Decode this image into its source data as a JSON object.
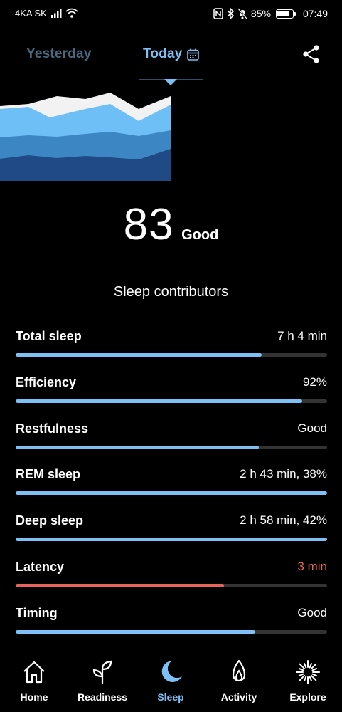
{
  "status_bar": {
    "carrier": "4KA SK",
    "battery": "85%",
    "battery_level": 0.85,
    "time": "07:49"
  },
  "tabs": {
    "yesterday": "Yesterday",
    "today": "Today",
    "active": "today"
  },
  "score": {
    "value": "83",
    "label": "Good"
  },
  "contributors_title": "Sleep contributors",
  "contributors": [
    {
      "label": "Total sleep",
      "value": "7 h 4 min",
      "progress": 0.79,
      "status": "normal"
    },
    {
      "label": "Efficiency",
      "value": "92%",
      "progress": 0.92,
      "status": "normal"
    },
    {
      "label": "Restfulness",
      "value": "Good",
      "progress": 0.78,
      "status": "normal"
    },
    {
      "label": "REM sleep",
      "value": "2 h 43 min, 38%",
      "progress": 1.0,
      "status": "normal"
    },
    {
      "label": "Deep sleep",
      "value": "2 h 58 min, 42%",
      "progress": 1.0,
      "status": "normal"
    },
    {
      "label": "Latency",
      "value": "3 min",
      "progress": 0.67,
      "status": "warning"
    },
    {
      "label": "Timing",
      "value": "Good",
      "progress": 0.77,
      "status": "normal"
    }
  ],
  "nav": {
    "home": "Home",
    "readiness": "Readiness",
    "sleep": "Sleep",
    "activity": "Activity",
    "explore": "Explore",
    "active": "sleep"
  },
  "colors": {
    "accent": "#7cc0f6",
    "warning": "#e8645a",
    "track": "#333333",
    "inactive_tab": "#4b6780",
    "awake": "#f2f2f2",
    "rem": "#6fbff7",
    "light": "#3c86c3",
    "deep": "#1f4a86"
  },
  "icons": {
    "calendar": "calendar-icon",
    "share": "share-icon",
    "home": "home-icon",
    "readiness": "sprout-icon",
    "sleep": "moon-icon",
    "activity": "flame-icon",
    "explore": "sparkle-icon"
  }
}
